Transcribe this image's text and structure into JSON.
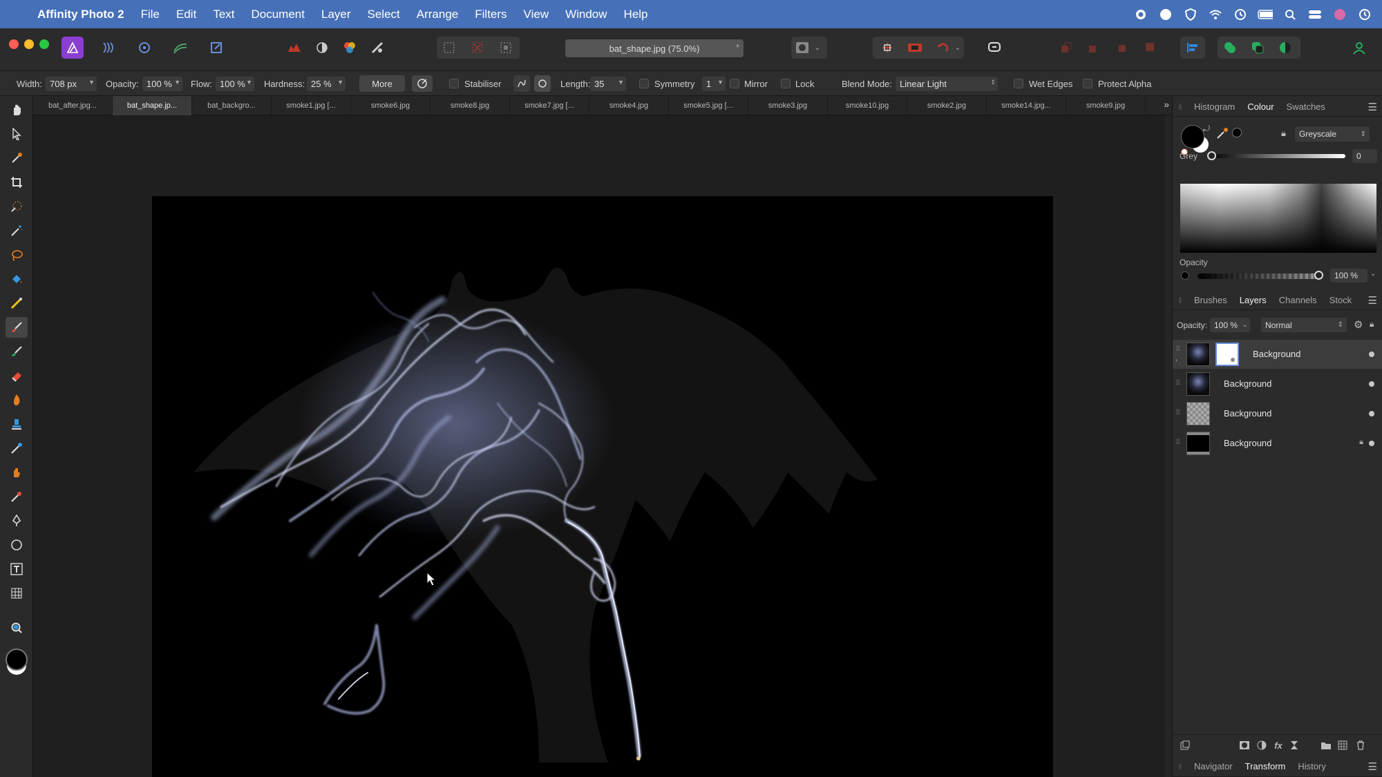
{
  "menubar": {
    "app_name": "Affinity Photo 2",
    "items": [
      "File",
      "Edit",
      "Text",
      "Document",
      "Layer",
      "Select",
      "Arrange",
      "Filters",
      "View",
      "Window",
      "Help"
    ]
  },
  "toolbar": {
    "document_title": "bat_shape.jpg (75.0%)",
    "title_star": "*"
  },
  "context_toolbar": {
    "width_label": "Width:",
    "width_value": "708 px",
    "opacity_label": "Opacity:",
    "opacity_value": "100 %",
    "flow_label": "Flow:",
    "flow_value": "100 %",
    "hardness_label": "Hardness:",
    "hardness_value": "25 %",
    "more_button": "More",
    "stabiliser_label": "Stabiliser",
    "length_label": "Length:",
    "length_value": "35",
    "symmetry_label": "Symmetry",
    "symmetry_value": "1",
    "mirror_label": "Mirror",
    "lock_label": "Lock",
    "blend_mode_label": "Blend Mode:",
    "blend_mode_value": "Linear Light",
    "wet_edges_label": "Wet Edges",
    "protect_alpha_label": "Protect Alpha"
  },
  "tabs": [
    {
      "label": "bat_after.jpg..."
    },
    {
      "label": "bat_shape.jp..."
    },
    {
      "label": "bat_backgro..."
    },
    {
      "label": "smoke1.jpg [..."
    },
    {
      "label": "smoke6.jpg"
    },
    {
      "label": "smoke8.jpg"
    },
    {
      "label": "smoke7.jpg [..."
    },
    {
      "label": "smoke4.jpg"
    },
    {
      "label": "smoke5.jpg [..."
    },
    {
      "label": "smoke3.jpg"
    },
    {
      "label": "smoke10.jpg"
    },
    {
      "label": "smoke2.jpg"
    },
    {
      "label": "smoke14.jpg..."
    },
    {
      "label": "smoke9.jpg"
    }
  ],
  "active_tab_index": 1,
  "colour_panel": {
    "tabs": [
      "Histogram",
      "Colour",
      "Swatches"
    ],
    "active_tab": "Colour",
    "model": "Greyscale",
    "grey_label": "Grey",
    "grey_value": "0",
    "opacity_label": "Opacity",
    "opacity_value": "100 %"
  },
  "layers_panel": {
    "tabs": [
      "Brushes",
      "Layers",
      "Channels",
      "Stock"
    ],
    "active_tab": "Layers",
    "opacity_label": "Opacity:",
    "opacity_value": "100 %",
    "blend_mode": "Normal",
    "layers": [
      {
        "name": "Background",
        "selected": true,
        "locked": false
      },
      {
        "name": "Background",
        "selected": false,
        "locked": false
      },
      {
        "name": "Background",
        "selected": false,
        "locked": false
      },
      {
        "name": "Background",
        "selected": false,
        "locked": true
      }
    ]
  },
  "bottom_panel": {
    "tabs": [
      "Navigator",
      "Transform",
      "History"
    ],
    "active_tab": "Transform"
  },
  "colors": {
    "menubar_bg": "#4670b8",
    "accent_purple": "#8a3fd1",
    "panel_bg": "#2b2b2b",
    "canvas_bg": "#000000",
    "smoke_tint": "#b8c4ee"
  }
}
